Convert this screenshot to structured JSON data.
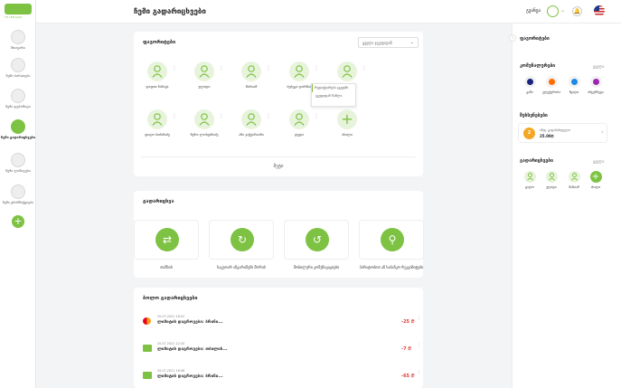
{
  "brand": {
    "logo_text": "TELEBANK",
    "accent": "#7dc242"
  },
  "nav": {
    "items": [
      {
        "label": "მთავარი"
      },
      {
        "label": "ჩემი ბარათები"
      },
      {
        "label": "ჩემი დეპოზიტი"
      },
      {
        "label": "ჩემი გადარიცხვები"
      },
      {
        "label": "ჩემი ლიმიტები"
      },
      {
        "label": "ჩემი ტრანზაქციები"
      }
    ],
    "add": "+"
  },
  "header": {
    "title": "ჩემი გადარიცხვები",
    "user": "გვანცა"
  },
  "favorites": {
    "title": "ფავორიტები",
    "filter": "ყველა ჯგუფიდან",
    "items": [
      {
        "label": "დავით ნანავა"
      },
      {
        "label": "ვლადი"
      },
      {
        "label": "მარიამ"
      },
      {
        "label": "ბუბუკა დარჩია"
      },
      {
        "label": ""
      },
      {
        "label": "დიტო ბიძინიძე"
      },
      {
        "label": "ნენო ლობჟანიძე"
      },
      {
        "label": "ანი ჯაჭვარიანი"
      },
      {
        "label": "დედა"
      },
      {
        "label": "ახალი"
      }
    ],
    "tooltip": {
      "edit": "რედაქტირება ჯგუფში",
      "remove": "ჯგუფიდან წაშლა"
    },
    "more": "მეტი"
  },
  "transfers": {
    "title": "გადარიცხვა",
    "items": [
      {
        "label": "თანხის"
      },
      {
        "label": "საკუთარ ანგარიშებს შორის"
      },
      {
        "label": "მობილური კომუნიკაციები"
      },
      {
        "label": "პირადობით ან საბანკო რეკვიზიტები"
      }
    ]
  },
  "recent": {
    "title": "ბოლო გადარიცხვები",
    "rows": [
      {
        "date": "20.07.2021 16:02",
        "desc": "ლიმიტის დაგროვება: ბრინი...",
        "amount": "-25 ₾"
      },
      {
        "date": "20.07.2021 12:20",
        "desc": "ლიმიტის დაგროვება: თბილის...",
        "amount": "-7 ₾"
      },
      {
        "date": "20.07.2021 16:08",
        "desc": "ლიმიტის დაგროვება: ბრინი...",
        "amount": "-65 ₾"
      }
    ]
  },
  "sidebar": {
    "title": "ფავორიტები",
    "utilities": {
      "title": "კომუნალურები",
      "all": "ყველა",
      "items": [
        {
          "label": "გაზი",
          "color": "#1a237e"
        },
        {
          "label": "ელექტრობა",
          "color": "#ff6d00"
        },
        {
          "label": "წყალი",
          "color": "#1e88e5"
        },
        {
          "label": "ინტერნეტი",
          "color": "#9c27b0"
        }
      ]
    },
    "reminder": {
      "title": "შეხსენებები",
      "badge": "2",
      "line1": "ინფ. გადასახდელი",
      "line2": "25.00₾"
    },
    "transfers": {
      "title": "გადარიცხვები",
      "all": "ყველა",
      "items": [
        {
          "label": "ცალო"
        },
        {
          "label": "ვლადი"
        },
        {
          "label": "მარიამ"
        },
        {
          "label": "ახალი"
        }
      ]
    }
  }
}
